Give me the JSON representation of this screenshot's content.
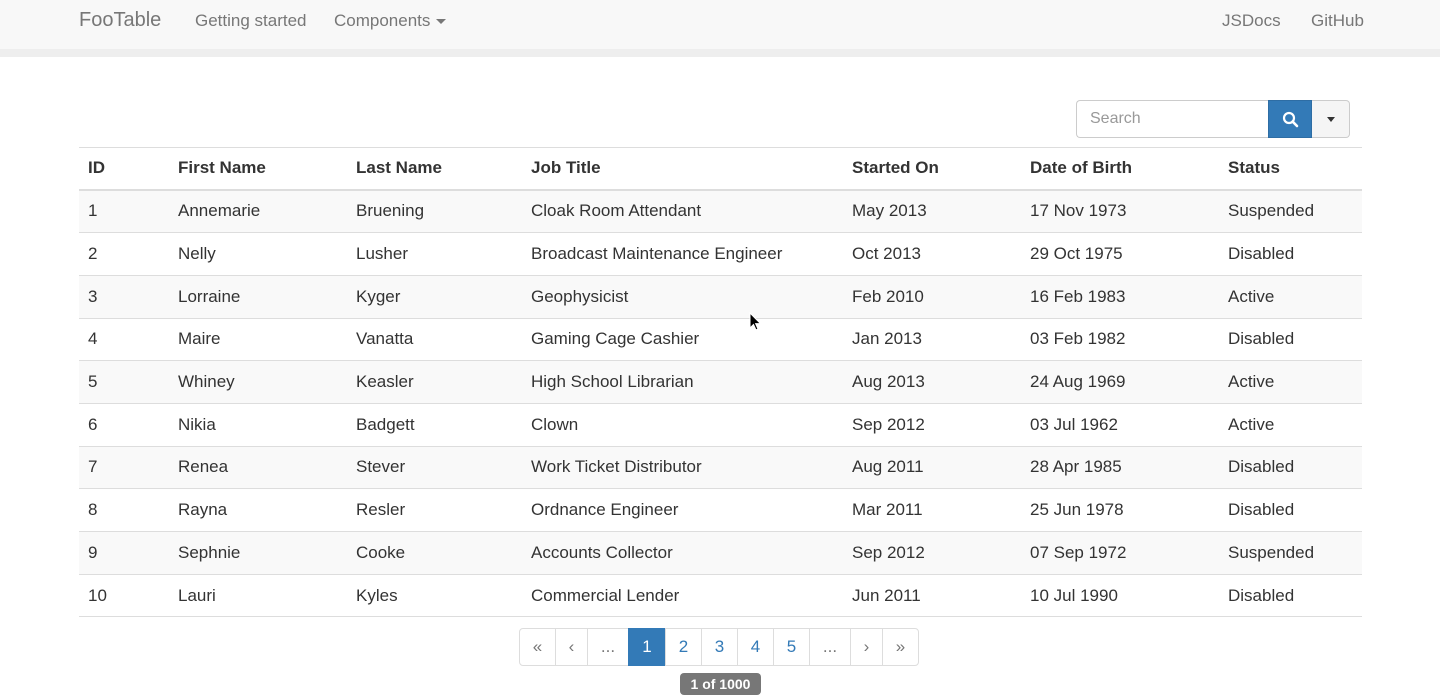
{
  "navbar": {
    "brand": "FooTable",
    "links": [
      "Getting started",
      "Components"
    ],
    "right_links": [
      "JSDocs",
      "GitHub"
    ]
  },
  "search": {
    "placeholder": "Search",
    "value": "",
    "button_icon": "search-icon",
    "dropdown_icon": "caret-down-icon"
  },
  "table": {
    "columns": [
      "ID",
      "First Name",
      "Last Name",
      "Job Title",
      "Started On",
      "Date of Birth",
      "Status"
    ],
    "rows": [
      [
        "1",
        "Annemarie",
        "Bruening",
        "Cloak Room Attendant",
        "May 2013",
        "17 Nov 1973",
        "Suspended"
      ],
      [
        "2",
        "Nelly",
        "Lusher",
        "Broadcast Maintenance Engineer",
        "Oct 2013",
        "29 Oct 1975",
        "Disabled"
      ],
      [
        "3",
        "Lorraine",
        "Kyger",
        "Geophysicist",
        "Feb 2010",
        "16 Feb 1983",
        "Active"
      ],
      [
        "4",
        "Maire",
        "Vanatta",
        "Gaming Cage Cashier",
        "Jan 2013",
        "03 Feb 1982",
        "Disabled"
      ],
      [
        "5",
        "Whiney",
        "Keasler",
        "High School Librarian",
        "Aug 2013",
        "24 Aug 1969",
        "Active"
      ],
      [
        "6",
        "Nikia",
        "Badgett",
        "Clown",
        "Sep 2012",
        "03 Jul 1962",
        "Active"
      ],
      [
        "7",
        "Renea",
        "Stever",
        "Work Ticket Distributor",
        "Aug 2011",
        "28 Apr 1985",
        "Disabled"
      ],
      [
        "8",
        "Rayna",
        "Resler",
        "Ordnance Engineer",
        "Mar 2011",
        "25 Jun 1978",
        "Disabled"
      ],
      [
        "9",
        "Sephnie",
        "Cooke",
        "Accounts Collector",
        "Sep 2012",
        "07 Sep 1972",
        "Suspended"
      ],
      [
        "10",
        "Lauri",
        "Kyles",
        "Commercial Lender",
        "Jun 2011",
        "10 Jul 1990",
        "Disabled"
      ]
    ]
  },
  "pagination": {
    "items": [
      "«",
      "‹",
      "...",
      "1",
      "2",
      "3",
      "4",
      "5",
      "...",
      "›",
      "»"
    ],
    "active": "1",
    "label": "1 of 1000"
  },
  "colors": {
    "primary": "#337ab7",
    "label_bg": "#777777",
    "navbar_bg": "#f8f8f8"
  }
}
